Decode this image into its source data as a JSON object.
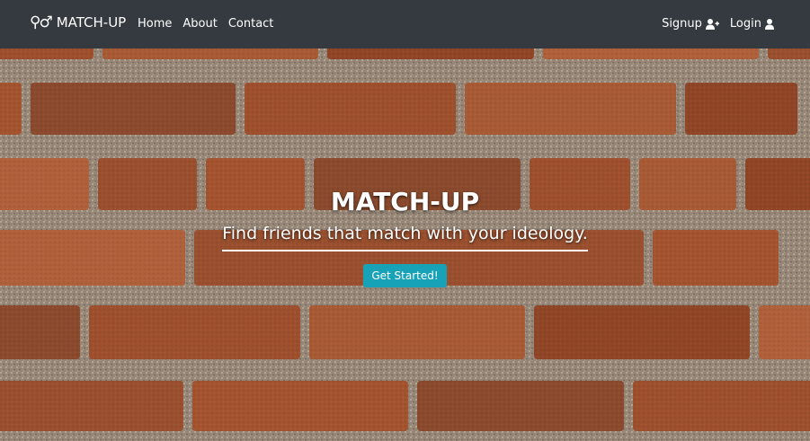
{
  "nav": {
    "brand": "MATCH-UP",
    "brand_icon": "gender-icon",
    "links": [
      "Home",
      "About",
      "Contact"
    ],
    "signup": "Signup",
    "login": "Login"
  },
  "hero": {
    "title": "MATCH-UP",
    "subtitle": "Find friends that match with your ideology.",
    "cta": "Get Started!"
  },
  "colors": {
    "navbar": "#343a40",
    "cta": "#17a2b8",
    "mortar": "#9a8b7e",
    "brick": "#a4532f"
  }
}
